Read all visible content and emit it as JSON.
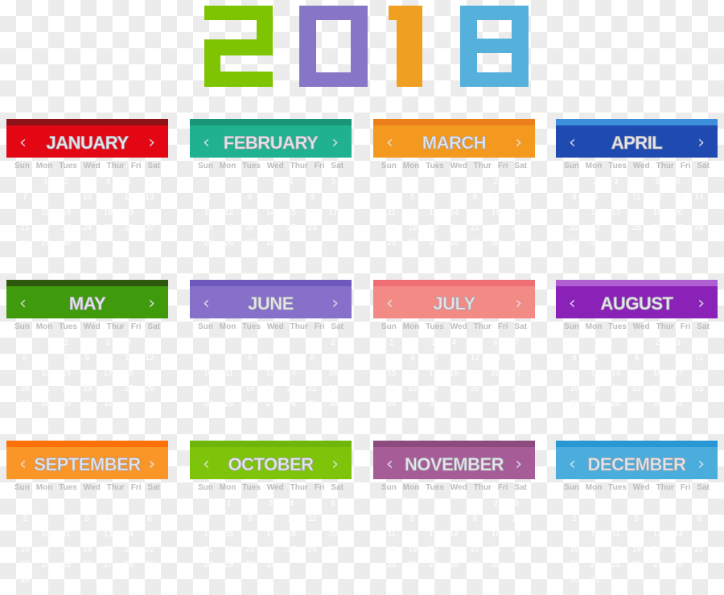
{
  "year": {
    "digits": [
      {
        "char": "2",
        "color": "#7fc400"
      },
      {
        "char": "0",
        "color": "#8776c7"
      },
      {
        "char": "1",
        "color": "#f0a020"
      },
      {
        "char": "8",
        "color": "#55b0dc"
      }
    ]
  },
  "weekdays": [
    "Sun",
    "Mon",
    "Tues",
    "Wed",
    "Thur",
    "Fri",
    "Sat"
  ],
  "nav": {
    "prev": "‹",
    "next": "›",
    "prev_icon": "chevron-left-icon",
    "next_icon": "chevron-right-icon"
  },
  "months": [
    {
      "name": "JANUARY",
      "color": "#e30613",
      "band": "#8e1218",
      "start": 1,
      "days": 31
    },
    {
      "name": "FEBRUARY",
      "color": "#20b290",
      "band": "#1a9577",
      "start": 4,
      "days": 28
    },
    {
      "name": "MARCH",
      "color": "#f39a1e",
      "band": "#ec7f1b",
      "start": 4,
      "days": 31
    },
    {
      "name": "APRIL",
      "color": "#1f4bb0",
      "band": "#3d8fdc",
      "start": 0,
      "days": 30
    },
    {
      "name": "MAY",
      "color": "#3f9a0c",
      "band": "#2f5a0e",
      "start": 2,
      "days": 31
    },
    {
      "name": "JUNE",
      "color": "#8670c9",
      "band": "#6d58bd",
      "start": 5,
      "days": 30
    },
    {
      "name": "JULY",
      "color": "#f28a86",
      "band": "#ee6e73",
      "start": 0,
      "days": 31
    },
    {
      "name": "AUGUST",
      "color": "#8a22b8",
      "band": "#b05fd2",
      "start": 3,
      "days": 31
    },
    {
      "name": "SEPTEMBER",
      "color": "#fa9527",
      "band": "#fb7108",
      "start": 6,
      "days": 30
    },
    {
      "name": "OCTOBER",
      "color": "#7dc40a",
      "band": "#6fb60a",
      "start": 1,
      "days": 31
    },
    {
      "name": "NOVEMBER",
      "color": "#a65c97",
      "band": "#8d4a7f",
      "start": 4,
      "days": 30
    },
    {
      "name": "DECEMBER",
      "color": "#4aaddc",
      "band": "#2a97d5",
      "start": 6,
      "days": 31
    }
  ]
}
